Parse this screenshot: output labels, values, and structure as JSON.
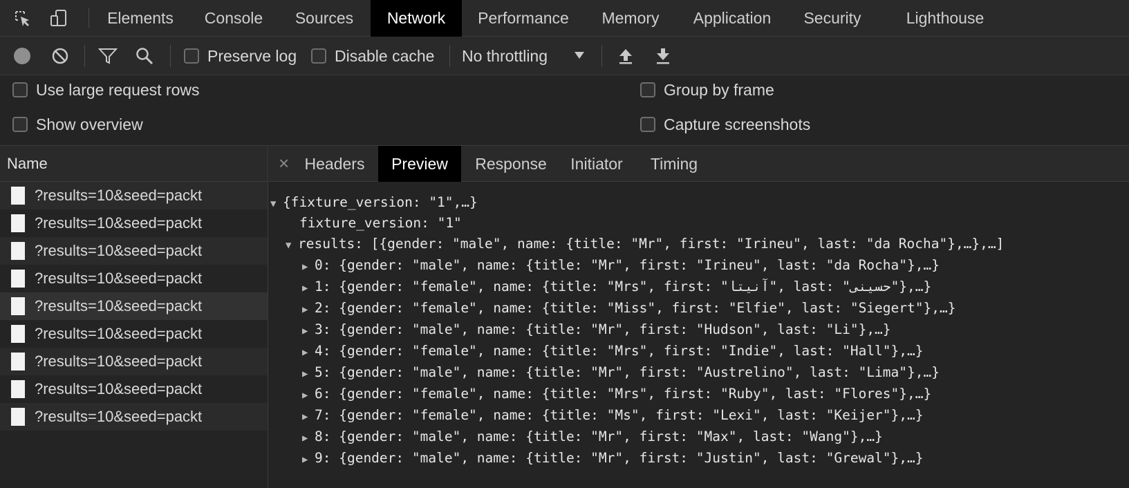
{
  "top_tabs": [
    "Elements",
    "Console",
    "Sources",
    "Network",
    "Performance",
    "Memory",
    "Application",
    "Security",
    "Lighthouse"
  ],
  "active_tab": "Network",
  "toolbar": {
    "preserve_log": "Preserve log",
    "disable_cache": "Disable cache",
    "throttling": "No throttling"
  },
  "settings": {
    "large_rows": "Use large request rows",
    "group_by_frame": "Group by frame",
    "show_overview": "Show overview",
    "capture_screenshots": "Capture screenshots"
  },
  "requests": {
    "header": "Name",
    "items": [
      "?results=10&seed=packt",
      "?results=10&seed=packt",
      "?results=10&seed=packt",
      "?results=10&seed=packt",
      "?results=10&seed=packt",
      "?results=10&seed=packt",
      "?results=10&seed=packt",
      "?results=10&seed=packt",
      "?results=10&seed=packt"
    ]
  },
  "detail_tabs": [
    "Headers",
    "Preview",
    "Response",
    "Initiator",
    "Timing"
  ],
  "active_detail_tab": "Preview",
  "preview": {
    "root": "{fixture_version: \"1\",…}",
    "fixture_version": "fixture_version: \"1\"",
    "results": "results: [{gender: \"male\", name: {title: \"Mr\", first: \"Irineu\", last: \"da Rocha\"},…},…]",
    "items": [
      "0: {gender: \"male\", name: {title: \"Mr\", first: \"Irineu\", last: \"da Rocha\"},…}",
      "1: {gender: \"female\", name: {title: \"Mrs\", first: \"آنیتا\", last: \"حسینی\"},…}",
      "2: {gender: \"female\", name: {title: \"Miss\", first: \"Elfie\", last: \"Siegert\"},…}",
      "3: {gender: \"male\", name: {title: \"Mr\", first: \"Hudson\", last: \"Li\"},…}",
      "4: {gender: \"female\", name: {title: \"Mrs\", first: \"Indie\", last: \"Hall\"},…}",
      "5: {gender: \"male\", name: {title: \"Mr\", first: \"Austrelino\", last: \"Lima\"},…}",
      "6: {gender: \"female\", name: {title: \"Mrs\", first: \"Ruby\", last: \"Flores\"},…}",
      "7: {gender: \"female\", name: {title: \"Ms\", first: \"Lexi\", last: \"Keijer\"},…}",
      "8: {gender: \"male\", name: {title: \"Mr\", first: \"Max\", last: \"Wang\"},…}",
      "9: {gender: \"male\", name: {title: \"Mr\", first: \"Justin\", last: \"Grewal\"},…}"
    ]
  },
  "icons": [
    "inspect-icon",
    "device-toggle-icon",
    "record-icon",
    "clear-icon",
    "filter-icon",
    "search-icon",
    "dropdown-arrow-icon",
    "import-har-icon",
    "export-har-icon",
    "close-icon",
    "document-icon",
    "expand-triangle-icon",
    "collapse-triangle-icon"
  ],
  "colors": {
    "background": "#242424",
    "toolbar": "#2a2a2a",
    "active_tab": "#000000",
    "text": "#e8e8e8"
  }
}
